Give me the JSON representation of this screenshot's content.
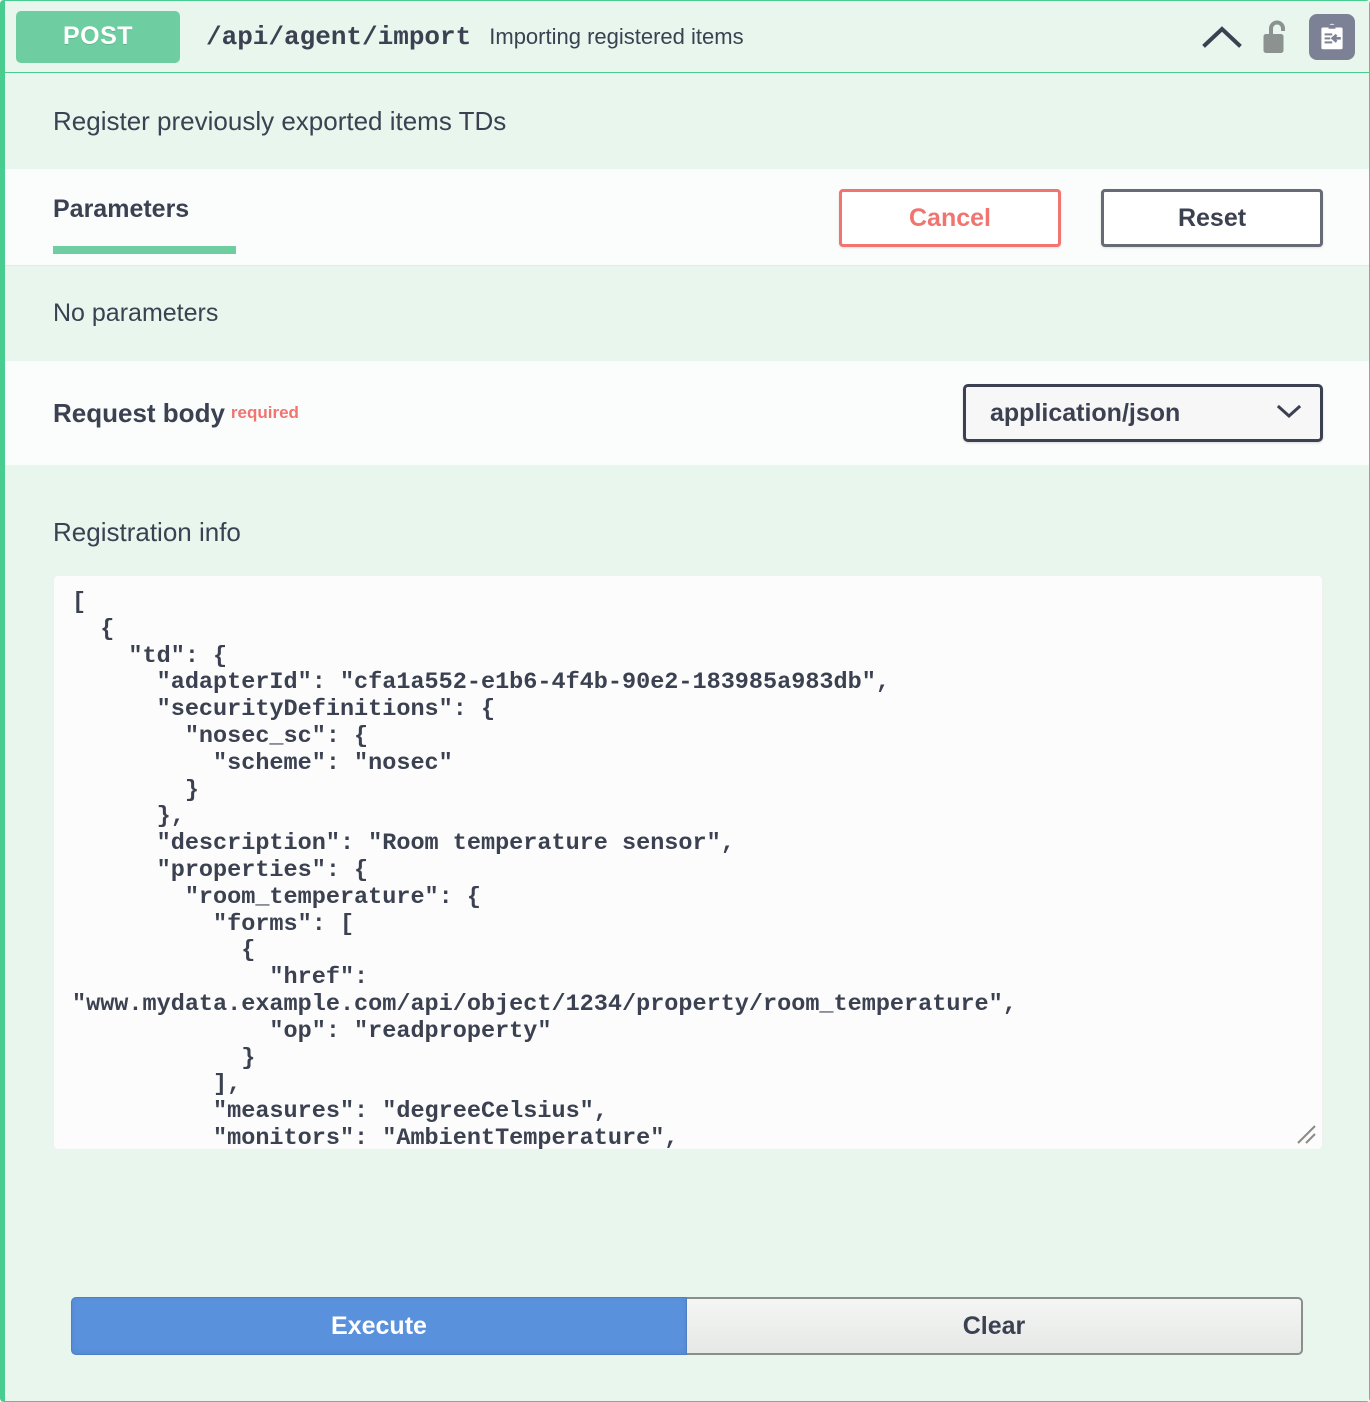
{
  "header": {
    "method": "POST",
    "path": "/api/agent/import",
    "summary": "Importing registered items",
    "icons": {
      "collapse": "chevron-up-icon",
      "auth": "unlocked-padlock-icon",
      "import": "clipboard-import-icon"
    },
    "method_color": "#6ecea1",
    "border_color": "#49cc90"
  },
  "description": "Register previously exported items TDs",
  "tabs": {
    "parameters_label": "Parameters",
    "cancel_label": "Cancel",
    "reset_label": "Reset",
    "cancel_color": "#f07470",
    "reset_color": "#666b75",
    "active_underline_color": "#6ecea1"
  },
  "parameters": {
    "empty_text": "No parameters"
  },
  "request_body": {
    "title": "Request body",
    "required_label": "required",
    "required_color": "#f07470",
    "content_type": "application/json",
    "content_type_options": [
      "application/json"
    ],
    "chevron": "chevron-down-icon"
  },
  "body_editor": {
    "label": "Registration info",
    "value": "[\n  {\n    \"td\": {\n      \"adapterId\": \"cfa1a552-e1b6-4f4b-90e2-183985a983db\",\n      \"securityDefinitions\": {\n        \"nosec_sc\": {\n          \"scheme\": \"nosec\"\n        }\n      },\n      \"description\": \"Room temperature sensor\",\n      \"properties\": {\n        \"room_temperature\": {\n          \"forms\": [\n            {\n              \"href\":\n\"www.mydata.example.com/api/object/1234/property/room_temperature\",\n              \"op\": \"readproperty\"\n            }\n          ],\n          \"measures\": \"degreeCelsius\",\n          \"monitors\": \"AmbientTemperature\",",
    "resize_handle": "resize-grip-icon"
  },
  "actions": {
    "execute_label": "Execute",
    "clear_label": "Clear",
    "execute_color": "#5a91dd"
  }
}
